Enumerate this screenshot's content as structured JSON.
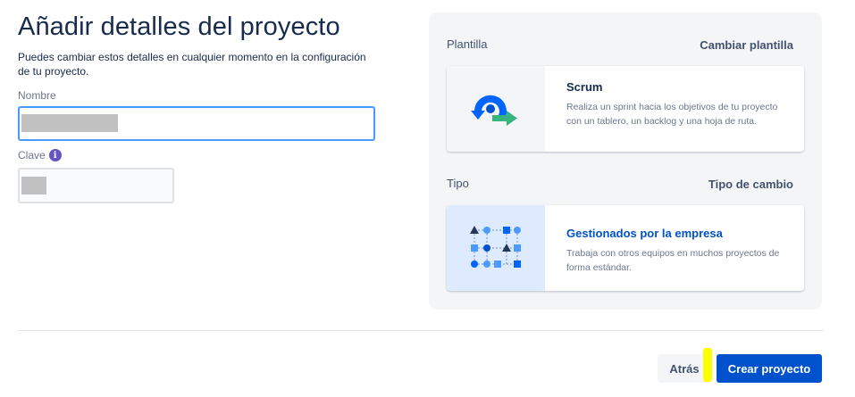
{
  "header": {
    "title": "Añadir detalles del proyecto",
    "subtitle": "Puedes cambiar estos detalles en cualquier momento en la configuración de tu proyecto."
  },
  "form": {
    "name_label": "Nombre",
    "key_label": "Clave",
    "info_icon_glyph": "i"
  },
  "template": {
    "section_label": "Plantilla",
    "change_label": "Cambiar plantilla",
    "card": {
      "icon": "scrum-icon",
      "title": "Scrum",
      "description": "Realiza un sprint hacia los objetivos de tu proyecto con un tablero, un backlog y una hoja de ruta."
    }
  },
  "type": {
    "section_label": "Tipo",
    "change_label": "Tipo de cambio",
    "card": {
      "icon": "company-managed-icon",
      "title": "Gestionados por la empresa",
      "description": "Trabaja con otros equipos en muchos proyectos de forma estándar."
    }
  },
  "footer": {
    "back_label": "Atrás",
    "create_label": "Crear proyecto"
  },
  "colors": {
    "primary": "#0052cc",
    "focus_border": "#4c9aff",
    "info": "#6554c0",
    "highlight": "#ffff00"
  }
}
